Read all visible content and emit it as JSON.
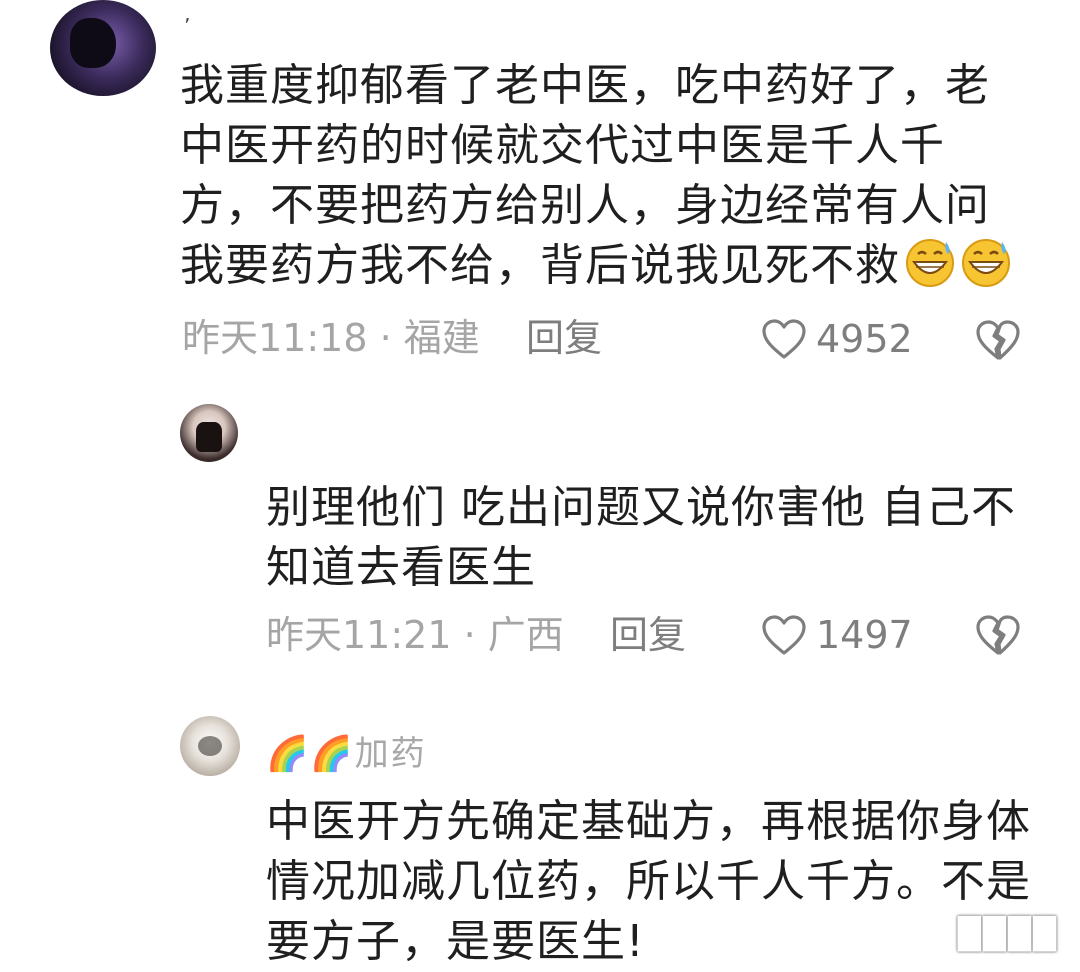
{
  "comments": [
    {
      "nickname": "’",
      "text": "我重度抑郁看了老中医，吃中药好了，老\n中医开药的时候就交代过中医是千人千\n方，不要把药方给别人，身边经常有人问\n我要药方我不给，背后说我见死不救",
      "emoji": "grinning-sweat-emoji",
      "time_location": "昨天11:18 · 福建",
      "reply_label": "回复",
      "like_count": "4952"
    },
    {
      "text": "别理他们 吃出问题又说你害他 自己不\n知道去看医生",
      "time_location": "昨天11:21 · 广西",
      "reply_label": "回复",
      "like_count": "1497"
    },
    {
      "nickname": "🌈🌈加药",
      "text": "中医开方先确定基础方，再根据你身体\n情况加减几位药，所以千人千方。不是\n要方子，是要医生!"
    }
  ],
  "watermark": "████",
  "colors": {
    "text": "#1f1f1f",
    "meta": "#a5a5a5",
    "action": "#7e7e7e"
  },
  "icons": {
    "like": "heart-outline-icon",
    "dislike": "broken-heart-icon"
  }
}
